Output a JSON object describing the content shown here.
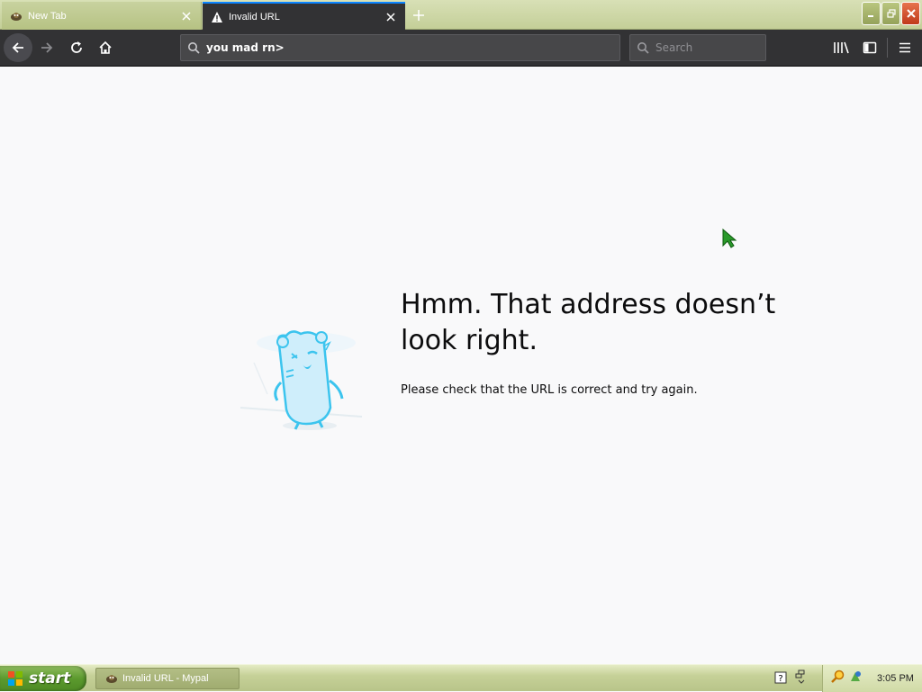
{
  "tabs": [
    {
      "title": "New Tab",
      "active": false
    },
    {
      "title": "Invalid URL",
      "active": true
    }
  ],
  "urlbar": {
    "value": "you mad rn>"
  },
  "searchbar": {
    "placeholder": "Search"
  },
  "error": {
    "title": "Hmm. That address doesn’t look right.",
    "description": "Please check that the URL is correct and try again."
  },
  "taskbar": {
    "start_label": "start",
    "task_item": "Invalid URL - Mypal",
    "clock": "3:05 PM"
  },
  "colors": {
    "toolbar": "#323234",
    "accent": "#0a84ff",
    "page_bg": "#f9f9fa",
    "taskbar": "#c6d198"
  }
}
